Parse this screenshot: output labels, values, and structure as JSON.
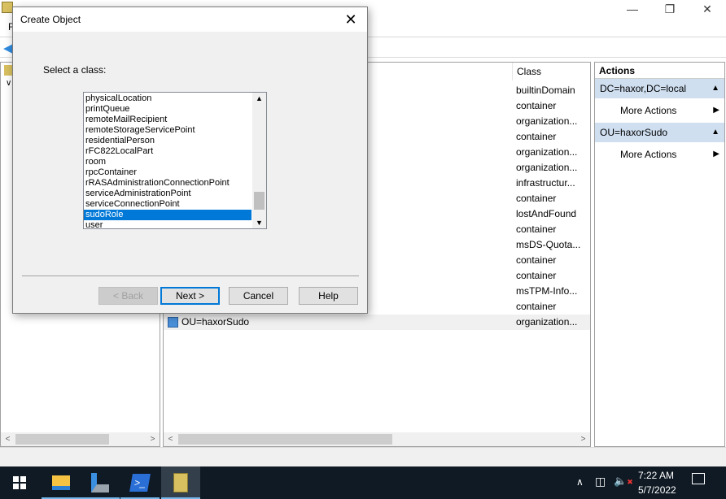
{
  "app": {
    "menu_first": "File"
  },
  "tree": {},
  "list": {
    "column_class": "Class",
    "rows": [
      {
        "name": "",
        "class": "builtinDomain"
      },
      {
        "name": "",
        "class": "container"
      },
      {
        "name": "",
        "class": "organization..."
      },
      {
        "name": "",
        "class": "container"
      },
      {
        "name": "",
        "class": "organization..."
      },
      {
        "name": "",
        "class": "organization..."
      },
      {
        "name": "",
        "class": "infrastructur..."
      },
      {
        "name": "",
        "class": "container"
      },
      {
        "name": "",
        "class": "lostAndFound"
      },
      {
        "name": "",
        "class": "container"
      },
      {
        "name": "",
        "class": "msDS-Quota..."
      },
      {
        "name": "",
        "class": "container"
      },
      {
        "name": "",
        "class": "container"
      },
      {
        "name": "",
        "class": "msTPM-Info..."
      },
      {
        "name": "",
        "class": "container"
      },
      {
        "name": "OU=haxorSudo",
        "class": "organization..."
      }
    ]
  },
  "actions": {
    "title": "Actions",
    "sections": [
      {
        "label": "DC=haxor,DC=local",
        "item": "More Actions"
      },
      {
        "label": "OU=haxorSudo",
        "item": "More Actions"
      }
    ]
  },
  "dialog": {
    "title": "Create Object",
    "prompt": "Select a class:",
    "classes": [
      "physicalLocation",
      "printQueue",
      "remoteMailRecipient",
      "remoteStorageServicePoint",
      "residentialPerson",
      "rFC822LocalPart",
      "room",
      "rpcContainer",
      "rRASAdministrationConnectionPoint",
      "serviceAdministrationPoint",
      "serviceConnectionPoint",
      "sudoRole",
      "user"
    ],
    "selected": "sudoRole",
    "buttons": {
      "back": "< Back",
      "next": "Next >",
      "cancel": "Cancel",
      "help": "Help"
    }
  },
  "taskbar": {
    "time": "7:22 AM",
    "date": "5/7/2022"
  },
  "colors": {
    "accent": "#0078d7",
    "action_section": "#cfdff0",
    "taskbar": "#0f1a24"
  }
}
